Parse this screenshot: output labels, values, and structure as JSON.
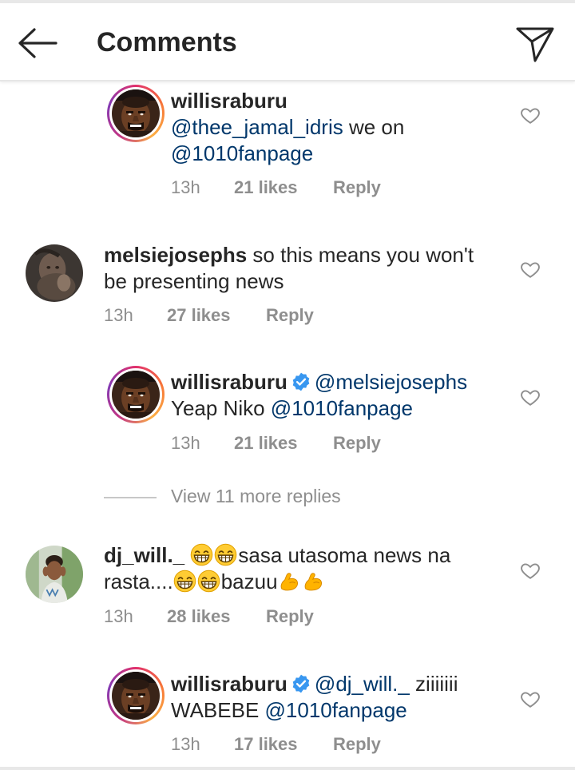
{
  "header": {
    "title": "Comments"
  },
  "comments": [
    {
      "username": "willisraburu",
      "text_parts": [
        "",
        "@thee_jamal_idris",
        " we on ",
        "@1010fanpage"
      ],
      "time": "13h",
      "likes": "21 likes",
      "reply": "Reply"
    },
    {
      "username": "melsiejosephs",
      "line1": " so this means you won't",
      "line2": "be presenting news",
      "time": "13h",
      "likes": "27 likes",
      "reply": "Reply"
    },
    {
      "username": "willisraburu",
      "mention1": "@melsiejosephs",
      "line2_text": "Yeap Niko ",
      "mention2": "@1010fanpage",
      "time": "13h",
      "likes": "21 likes",
      "reply": "Reply"
    },
    {
      "username": "dj_will._",
      "line1_text": "sasa utasoma news na",
      "line2_pre": "rasta....",
      "line2_text": "bazuu",
      "time": "13h",
      "likes": "28 likes",
      "reply": "Reply"
    },
    {
      "username": "willisraburu",
      "mention1": "@dj_will._",
      "line1_text": " ziiiiiii",
      "line2_text": "WABEBE ",
      "mention2": "@1010fanpage",
      "time": "13h",
      "likes": "17 likes",
      "reply": "Reply"
    }
  ],
  "view_more": "View 11 more replies",
  "colors": {
    "mention": "#00376b",
    "meta": "#8e8e8e",
    "verified": "#3897f0"
  },
  "icons": {
    "back": "back-arrow-icon",
    "send": "send-icon",
    "like": "heart-icon",
    "verified": "verified-badge-icon",
    "grin": "grinning-emoji-icon",
    "flex": "flexed-biceps-emoji-icon"
  }
}
